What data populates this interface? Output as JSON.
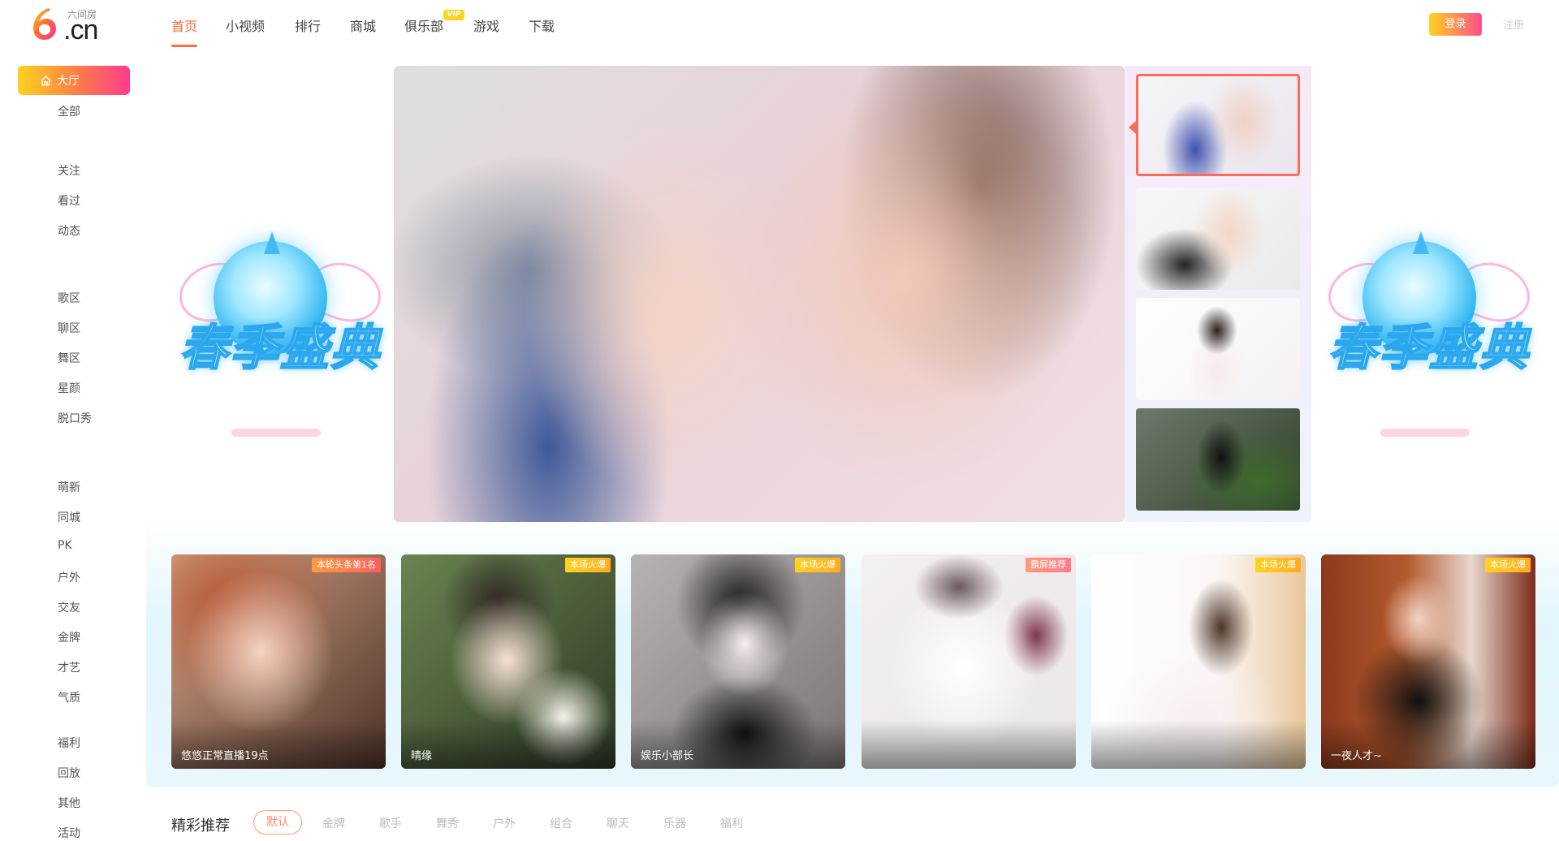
{
  "brand": {
    "small_name": "六间房",
    "domain": ".cn"
  },
  "nav": {
    "items": [
      "首页",
      "小视频",
      "排行",
      "商城",
      "俱乐部",
      "游戏",
      "下载"
    ],
    "vip_badge": "VIP",
    "login": "登录",
    "register": "注册"
  },
  "sidebar": {
    "hall": "大厅",
    "groups": [
      [
        "全部"
      ],
      [
        "关注",
        "看过",
        "动态"
      ],
      [
        "歌区",
        "聊区",
        "舞区",
        "星颜",
        "脱口秀"
      ],
      [
        "萌新",
        "同城",
        "PK",
        "户外",
        "交友",
        "金牌",
        "才艺",
        "气质"
      ],
      [
        "福利",
        "回放",
        "其他",
        "活动"
      ]
    ]
  },
  "banner": {
    "title": "春季盛典"
  },
  "rooms": [
    {
      "tag": "本轮头条第1名",
      "name": "悠悠正常直播19点"
    },
    {
      "tag": "本场火爆",
      "name": "晴缘"
    },
    {
      "tag": "本场火爆",
      "name": "娱乐小部长"
    },
    {
      "tag": "霸屏推荐",
      "name": ""
    },
    {
      "tag": "本场火爆",
      "name": ""
    },
    {
      "tag": "本场火爆",
      "name": "一夜人才~"
    }
  ],
  "recommend": {
    "title": "精彩推荐",
    "chips": [
      "默认",
      "金牌",
      "歌手",
      "舞秀",
      "户外",
      "组合",
      "聊天",
      "乐器",
      "福利"
    ]
  },
  "colors": {
    "accent": "#ff6a3d",
    "hall_gradient": [
      "#ffd21f",
      "#ff7a4a",
      "#ff3d8b"
    ]
  }
}
